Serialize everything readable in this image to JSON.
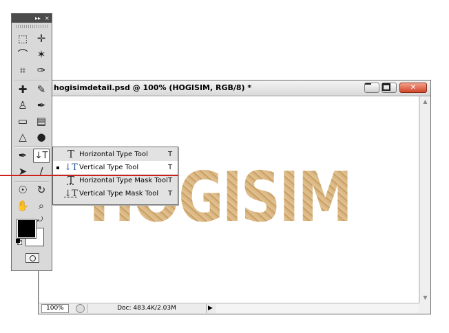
{
  "document": {
    "title": "hogisimdetail.psd @ 100% (HOGISIM, RGB/8) *",
    "canvas_text": "HOGISIM",
    "status": {
      "zoom": "100%",
      "doc_info": "Doc: 483.4K/2.03M"
    }
  },
  "toolbox": {
    "header_glyphs": {
      "collapse": "▸▸",
      "close": "×"
    },
    "tools": [
      {
        "name": "marquee",
        "glyph": "⬚"
      },
      {
        "name": "move",
        "glyph": "✛"
      },
      {
        "name": "lasso",
        "glyph": "⌒"
      },
      {
        "name": "magic-wand",
        "glyph": "✶"
      },
      {
        "name": "crop",
        "glyph": "⌗"
      },
      {
        "name": "eyedropper",
        "glyph": "✑"
      },
      {
        "name": "healing",
        "glyph": "✚"
      },
      {
        "name": "brush",
        "glyph": "✎"
      },
      {
        "name": "stamp",
        "glyph": "♙"
      },
      {
        "name": "history-brush",
        "glyph": "✒"
      },
      {
        "name": "eraser",
        "glyph": "▭"
      },
      {
        "name": "gradient",
        "glyph": "▤"
      },
      {
        "name": "blur",
        "glyph": "△"
      },
      {
        "name": "dodge",
        "glyph": "●"
      },
      {
        "name": "pen",
        "glyph": "✒"
      },
      {
        "name": "type",
        "glyph": "↓T"
      },
      {
        "name": "path-selection",
        "glyph": "➤"
      },
      {
        "name": "line",
        "glyph": "∕"
      },
      {
        "name": "3d-rotate",
        "glyph": "☉"
      },
      {
        "name": "3d-orbit",
        "glyph": "↻"
      },
      {
        "name": "hand",
        "glyph": "✋"
      },
      {
        "name": "zoom",
        "glyph": "⌕"
      }
    ]
  },
  "flyout": {
    "items": [
      {
        "label": "Horizontal Type Tool",
        "shortcut": "T",
        "glyph": "T",
        "selected": false
      },
      {
        "label": "Vertical Type Tool",
        "shortcut": "T",
        "glyph": "↓T",
        "selected": true
      },
      {
        "label": "Horizontal Type Mask Tool",
        "shortcut": "T",
        "glyph": "T",
        "selected": false
      },
      {
        "label": "Vertical Type Mask Tool",
        "shortcut": "T",
        "glyph": "↓T",
        "selected": false
      }
    ]
  },
  "colors": {
    "foreground": "#000000",
    "background": "#ffffff",
    "highlight_line": "#d0201b"
  }
}
